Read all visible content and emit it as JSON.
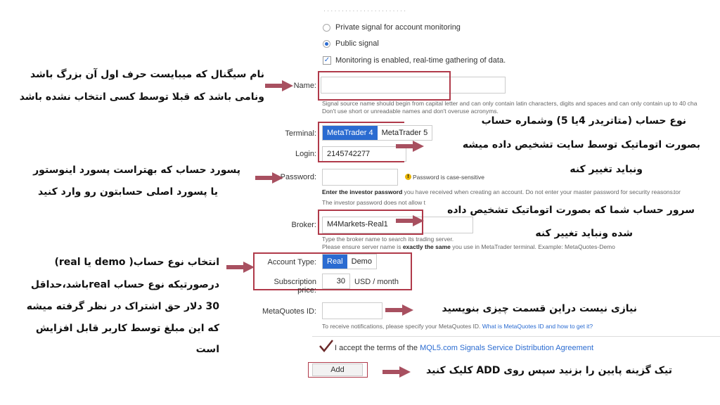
{
  "form": {
    "signal_type": {
      "private_label": "Private signal for account monitoring",
      "public_label": "Public signal",
      "monitoring_label": "Monitoring is enabled, real-time gathering of data."
    },
    "name": {
      "label": "Name:",
      "value": "",
      "hint1": "Signal source name should begin from capital letter and can only contain latin characters, digits and spaces and can only contain up to 40 cha",
      "hint2": "Don't use short or unreadable names and don't overuse acronyms."
    },
    "terminal": {
      "label": "Terminal:",
      "options": [
        "MetaTrader 4",
        "MetaTrader 5"
      ],
      "selected": "MetaTrader 4"
    },
    "login": {
      "label": "Login:",
      "value": "2145742277"
    },
    "password": {
      "label": "Password:",
      "warning": "Password is case-sensitive",
      "hint1_bold": "Enter the investor password",
      "hint1_rest": " you have received when creating an account. Do not enter your master password for security reasons.",
      "hint1_end": "tor",
      "hint2": "The investor password does not allow t"
    },
    "broker": {
      "label": "Broker:",
      "value": "M4Markets-Real1",
      "hint1": "Type the broker name to search its trading server.",
      "hint2_pre": "Please ensure server name is ",
      "hint2_bold": "exactly the same",
      "hint2_post": " you use in MetaTrader terminal. Example: MetaQuotes-Demo"
    },
    "account_type": {
      "label": "Account Type:",
      "options": [
        "Real",
        "Demo"
      ],
      "selected": "Real"
    },
    "subscription": {
      "label": "Subscription price:",
      "value": "30",
      "unit": "USD / month"
    },
    "metaquotes": {
      "label": "MetaQuotes ID:",
      "hint_pre": "To receive notifications, please specify your MetaQuotes ID.",
      "hint_link": "What is MetaQuotes ID and how to get it?"
    },
    "terms": {
      "pre": "I accept the terms of the ",
      "link": "MQL5.com Signals Service Distribution Agreement"
    },
    "add_button": "Add"
  },
  "annotations": {
    "name_1": "نام سیگنال که میبایست حرف اول آن بزرگ باشد",
    "name_2": "ونامی باشد که قبلا توسط کسی انتخاب نشده باشد",
    "terminal_1": "نوع حساب  (متاتریدر 4یا 5) وشماره حساب",
    "terminal_2": "بصورت اتوماتیک توسط  سایت تشخیص داده میشه",
    "terminal_3": "ونباید تغییر کنه",
    "password_1": "پسورد حساب که بهتراست پسورد اینوستور",
    "password_2": "یا پسورد اصلی حسابتون رو وارد کنید",
    "broker_1": "سرور حساب شما که بصورت اتوماتیک تشخیص داده",
    "broker_2": "شده ونباید تغییر کنه",
    "account_1": "انتخاب نوع حساب( demo یا real)",
    "account_2": "درصورتیکه نوع حساب realباشد،حداقل",
    "account_3": "30 دلار حق اشتراک در نظر گرفته میشه",
    "account_4": "که این مبلغ توسط کاربر قابل افزایش",
    "account_5": "است",
    "metaquotes_1": "نیازی نیست دراین قسمت چیزی بنویسید",
    "add_1": "تیک گزینه پایین را بزنید سپس روی ADD کلیک کنید"
  },
  "colors": {
    "accent": "#2a6bd1",
    "annotation_red": "#b03a4a",
    "arrow": "#a85060"
  }
}
